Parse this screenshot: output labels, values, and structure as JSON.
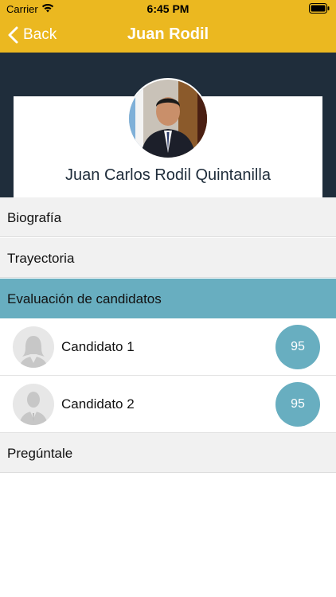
{
  "status": {
    "carrier": "Carrier",
    "time": "6:45 PM"
  },
  "nav": {
    "back_label": "Back",
    "title": "Juan Rodil"
  },
  "profile": {
    "name": "Juan Carlos Rodil Quintanilla"
  },
  "sections": [
    {
      "label": "Biografía"
    },
    {
      "label": "Trayectoria"
    },
    {
      "label": "Evaluación de candidatos"
    },
    {
      "label": "Pregúntale"
    }
  ],
  "candidates": [
    {
      "name": "Candidato 1",
      "score": "95",
      "avatar": "female-silhouette-icon"
    },
    {
      "name": "Candidato 2",
      "score": "95",
      "avatar": "male-silhouette-icon"
    }
  ],
  "colors": {
    "nav_bar": "#ebb820",
    "hero_bg": "#1f2d3b",
    "accent": "#68aec0",
    "section_bg": "#f1f1f1"
  }
}
